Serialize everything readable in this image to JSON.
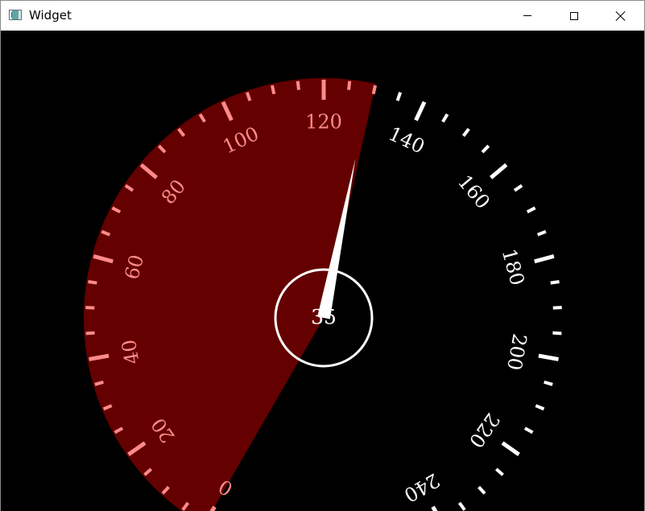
{
  "window": {
    "title": "Widget",
    "minimize_icon": "minimize-icon",
    "maximize_icon": "maximize-icon",
    "close_icon": "close-icon",
    "app_icon": "window-app-icon"
  },
  "gauge": {
    "min": 0,
    "max": 240,
    "value": 35,
    "display_value": "35",
    "labels": [
      "0",
      "20",
      "40",
      "60",
      "80",
      "100",
      "120",
      "140",
      "160",
      "180",
      "200",
      "220",
      "240"
    ],
    "colors": {
      "background": "#000000",
      "active_fill": "#640000",
      "active_tick": "#ff8a8a",
      "inactive_tick": "#ffffff",
      "needle": "#ffffff",
      "center_ring": "#ffffff"
    }
  }
}
